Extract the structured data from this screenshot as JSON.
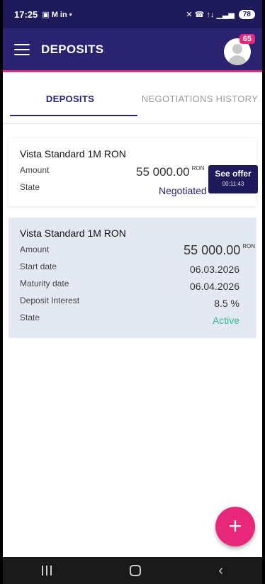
{
  "status_bar": {
    "time": "17:25",
    "left_icons": "▣ M in •",
    "right_icons": "✕ ☎ ↑↓ ▁▃▅",
    "battery": "78"
  },
  "app_bar": {
    "title": "DEPOSITS",
    "notification_count": "65"
  },
  "tabs": [
    {
      "label": "DEPOSITS",
      "active": true
    },
    {
      "label": "NEGOTIATIONS HISTORY",
      "active": false
    }
  ],
  "offer_card": {
    "title": "Vista Standard 1M RON",
    "amount_label": "Amount",
    "amount_value": "55 000.00",
    "currency": "RON",
    "state_label": "State",
    "state_value": "Negotiated",
    "button_label": "See offer",
    "button_timer": "00:11:43"
  },
  "deposit_card": {
    "title": "Vista Standard 1M RON",
    "amount_label": "Amount",
    "amount_value": "55 000.00",
    "currency": "RON",
    "start_label": "Start date",
    "start_value": "06.03.2026",
    "maturity_label": "Maturity date",
    "maturity_value": "06.04.2026",
    "interest_label": "Deposit Interest",
    "interest_value": "8.5 %",
    "state_label": "State",
    "state_value": "Active"
  },
  "fab": {
    "icon": "plus-icon",
    "symbol": "+"
  },
  "colors": {
    "primary": "#2a2370",
    "accent": "#e8287a",
    "active_green": "#2dbf8a",
    "card_bg": "#e4e8f3"
  }
}
